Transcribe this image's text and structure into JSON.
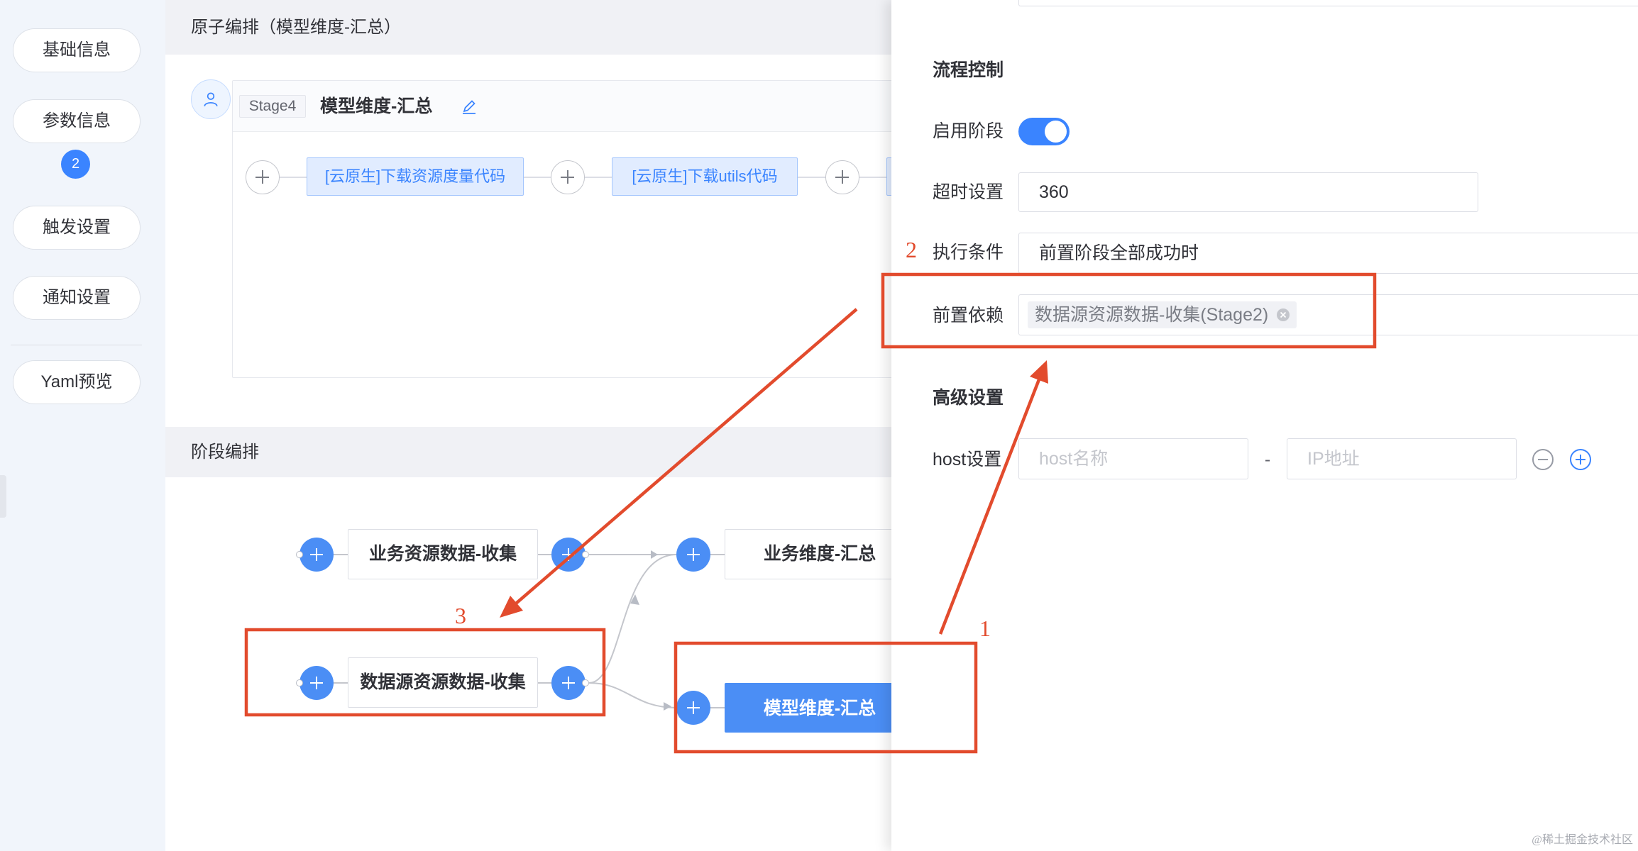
{
  "sidebar": {
    "items": [
      {
        "label": "基础信息"
      },
      {
        "label": "参数信息",
        "badge": "2"
      },
      {
        "label": "触发设置"
      },
      {
        "label": "通知设置"
      },
      {
        "label": "Yaml预览"
      }
    ]
  },
  "atom_section": {
    "title": "原子编排（模型维度-汇总）",
    "stage": {
      "tag": "Stage4",
      "name": "模型维度-汇总"
    },
    "atoms": [
      {
        "label": "[云原生]下载资源度量代码"
      },
      {
        "label": "[云原生]下载utils代码"
      }
    ]
  },
  "stage_section": {
    "title": "阶段编排",
    "nodes": [
      {
        "label": "业务资源数据-收集"
      },
      {
        "label": "业务维度-汇总"
      },
      {
        "label": "数据源资源数据-收集"
      },
      {
        "label": "模型维度-汇总",
        "selected": true
      }
    ]
  },
  "panel": {
    "flow_control": {
      "title": "流程控制",
      "enable_label": "启用阶段",
      "enable_value": true,
      "timeout_label": "超时设置",
      "timeout_value": "360",
      "condition_label": "执行条件",
      "condition_value": "前置阶段全部成功时",
      "dependency_label": "前置依赖",
      "dependency_tags": [
        "数据源资源数据-收集(Stage2)"
      ]
    },
    "advanced": {
      "title": "高级设置",
      "host_label": "host设置",
      "host_name_placeholder": "host名称",
      "separator": "-",
      "ip_placeholder": "IP地址"
    }
  },
  "annotations": {
    "labels": {
      "one": "1",
      "two": "2",
      "three": "3"
    },
    "color": "#e24b2d"
  },
  "watermark": "@稀土掘金技术社区",
  "icons": [
    "user-icon",
    "pencil-icon",
    "plus-icon",
    "close-icon",
    "minus-circle-icon",
    "plus-circle-icon"
  ],
  "colors": {
    "primary": "#3a84ff",
    "atom_bg": "#e1ecff",
    "annotation": "#e24b2d"
  }
}
